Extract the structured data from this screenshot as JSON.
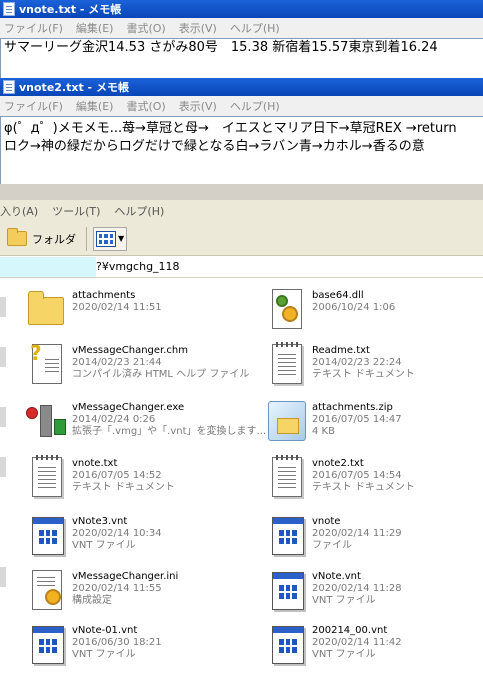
{
  "notepad1": {
    "title": "vnote.txt - メモ帳",
    "menu": [
      "ファイル(F)",
      "編集(E)",
      "書式(O)",
      "表示(V)",
      "ヘルプ(H)"
    ],
    "lines": [
      "サマーリーグ金沢14.53 さがみ80号　15.38 新宿着15.57東京到着16.24"
    ]
  },
  "notepad2": {
    "title": "vnote2.txt - メモ帳",
    "menu": [
      "ファイル(F)",
      "編集(E)",
      "書式(O)",
      "表示(V)",
      "ヘルプ(H)"
    ],
    "lines": [
      "φ(゜д゜)メモメモ...苺→草冠と母→　イエスとマリア日下→草冠REX →return",
      "ロク→神の緑だからログだけで緑となる白→ラバン青→カホル→香るの意"
    ]
  },
  "explorer": {
    "menu": [
      "入り(A)",
      "ツール(T)",
      "ヘルプ(H)"
    ],
    "folder_button": "フォルダ",
    "address": "?¥vmgchg_118",
    "files": [
      {
        "name": "attachments",
        "meta": [
          "2020/02/14 11:51"
        ],
        "icon": "folder-icon"
      },
      {
        "name": "base64.dll",
        "meta": [
          "2006/10/24 1:06"
        ],
        "icon": "dll-icon"
      },
      {
        "name": "vMessageChanger.chm",
        "meta": [
          "2014/02/23 21:44",
          "コンパイル済み HTML ヘルプ ファイル"
        ],
        "icon": "chm-icon"
      },
      {
        "name": "Readme.txt",
        "meta": [
          "2014/02/23 22:24",
          "テキスト ドキュメント"
        ],
        "icon": "text-document-icon"
      },
      {
        "name": "vMessageChanger.exe",
        "meta": [
          "2014/02/24 0:26",
          "拡張子「.vmg」や「.vnt」を変換します..."
        ],
        "icon": "exe-icon"
      },
      {
        "name": "attachments.zip",
        "meta": [
          "2016/07/05 14:47",
          "4 KB"
        ],
        "icon": "zip-icon"
      },
      {
        "name": "vnote.txt",
        "meta": [
          "2016/07/05 14:52",
          "テキスト ドキュメント"
        ],
        "icon": "text-document-icon"
      },
      {
        "name": "vnote2.txt",
        "meta": [
          "2016/07/05 14:54",
          "テキスト ドキュメント"
        ],
        "icon": "text-document-icon"
      },
      {
        "name": "vNote3.vnt",
        "meta": [
          "2020/02/14 10:34",
          "VNT ファイル"
        ],
        "icon": "vnt-file-icon"
      },
      {
        "name": "vnote",
        "meta": [
          "2020/02/14 11:29",
          "ファイル"
        ],
        "icon": "generic-file-icon"
      },
      {
        "name": "vMessageChanger.ini",
        "meta": [
          "2020/02/14 11:55",
          "構成設定"
        ],
        "icon": "ini-icon"
      },
      {
        "name": "vNote.vnt",
        "meta": [
          "2020/02/14 11:28",
          "VNT ファイル"
        ],
        "icon": "vnt-file-icon"
      },
      {
        "name": "vNote-01.vnt",
        "meta": [
          "2016/06/30 18:21",
          "VNT ファイル"
        ],
        "icon": "vnt-file-icon"
      },
      {
        "name": "200214_00.vnt",
        "meta": [
          "2020/02/14 11:42",
          "VNT ファイル"
        ],
        "icon": "vnt-file-icon"
      }
    ]
  }
}
